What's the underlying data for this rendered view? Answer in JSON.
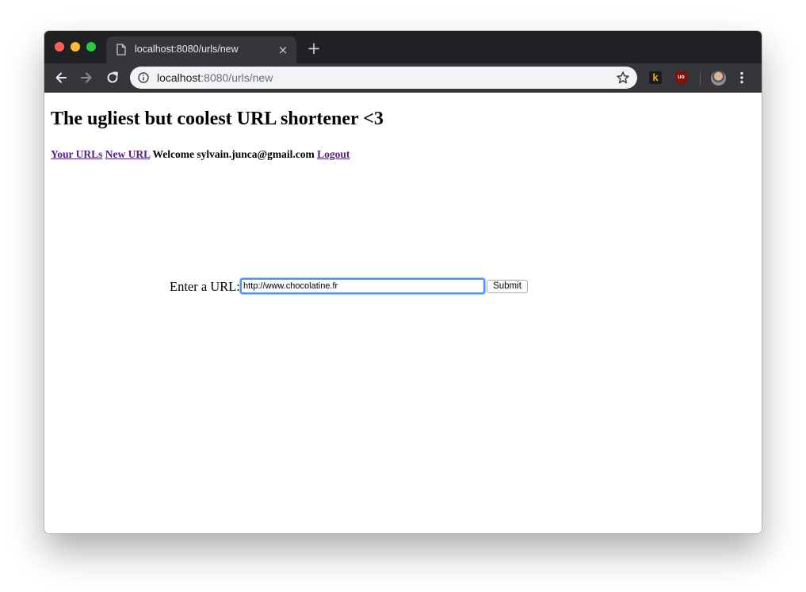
{
  "browser": {
    "tab_title": "localhost:8080/urls/new",
    "new_tab_label": "+",
    "close_tab_label": "×",
    "address_host": "localhost",
    "address_rest": ":8080/urls/new",
    "extension_k_label": "k",
    "extension_ub_label": "uo",
    "icons": [
      "back-icon",
      "forward-icon",
      "reload-icon",
      "info-icon",
      "star-icon",
      "menu-icon",
      "page-icon"
    ]
  },
  "page": {
    "title": "The ugliest but coolest URL shortener <3",
    "nav": {
      "your_urls": "Your URLs",
      "new_url": "New URL",
      "welcome": "Welcome sylvain.junca@gmail.com",
      "logout": "Logout"
    },
    "form": {
      "label": "Enter a URL:",
      "url_value": "http://www.chocolatine.fr",
      "submit_label": "Submit"
    }
  },
  "colors": {
    "tab_strip": "#202124",
    "toolbar": "#35363a",
    "visited_link": "#551a8b",
    "focus_ring": "#4d90fe"
  }
}
